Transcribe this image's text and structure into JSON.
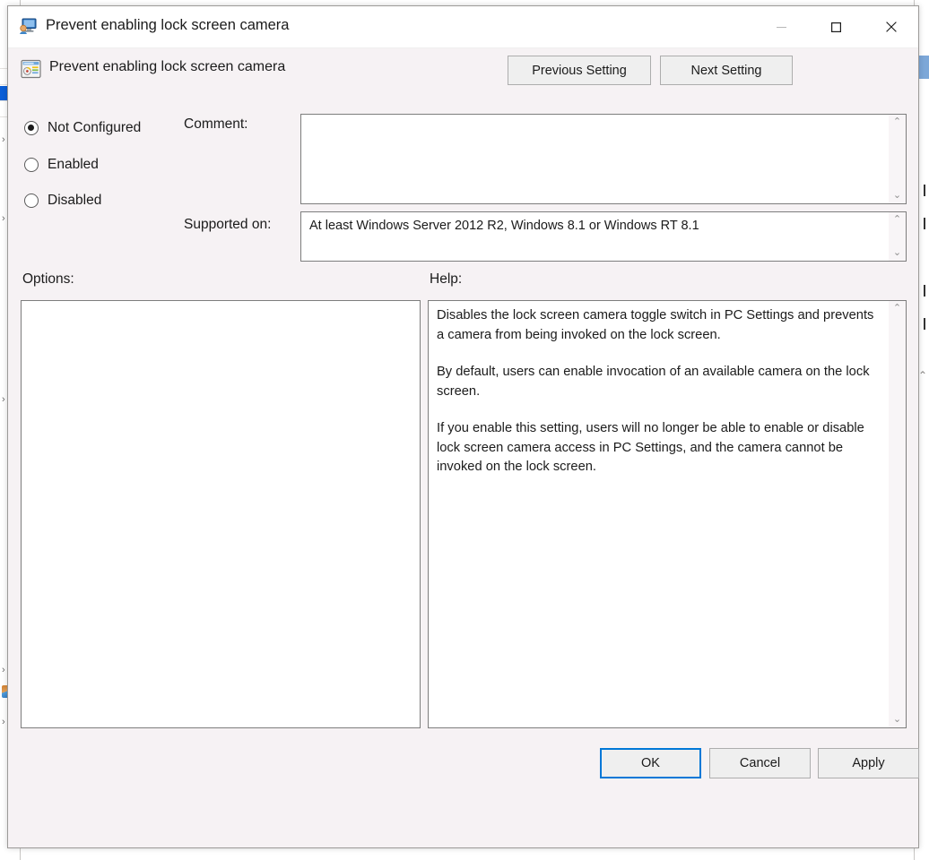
{
  "window": {
    "title": "Prevent enabling lock screen camera",
    "title_icon": "computer-monitor-icon",
    "minimize_label": "Minimize",
    "maximize_label": "Maximize",
    "close_label": "Close"
  },
  "header": {
    "title": "Prevent enabling lock screen camera",
    "icon": "policy-setting-icon",
    "previous_setting": "Previous Setting",
    "next_setting": "Next Setting"
  },
  "state": {
    "options": [
      {
        "label": "Not Configured",
        "selected": true
      },
      {
        "label": "Enabled",
        "selected": false
      },
      {
        "label": "Disabled",
        "selected": false
      }
    ]
  },
  "comment": {
    "label": "Comment:",
    "value": "",
    "scroll_up": "⌃",
    "scroll_down": "⌄"
  },
  "supported": {
    "label": "Supported on:",
    "value": "At least Windows Server 2012 R2, Windows 8.1 or Windows RT 8.1",
    "scroll_up": "⌃",
    "scroll_down": "⌄"
  },
  "sections": {
    "options_label": "Options:",
    "help_label": "Help:"
  },
  "options_panel": {
    "content": ""
  },
  "help": {
    "paragraphs": [
      "Disables the lock screen camera toggle switch in PC Settings and prevents a camera from being invoked on the lock screen.",
      "By default, users can enable invocation of an available camera on the lock screen.",
      "If you enable this setting, users will no longer be able to enable or disable lock screen camera access in PC Settings, and the camera cannot be invoked on the lock screen."
    ],
    "scroll_up": "⌃",
    "scroll_down": "⌄"
  },
  "footer": {
    "ok": "OK",
    "cancel": "Cancel",
    "apply": "Apply"
  },
  "colors": {
    "dialog_bg": "#f6f2f4",
    "titlebar_bg": "#ffffff",
    "focus_blue": "#0078d7",
    "selection_blue": "#0a5ed7",
    "button_face": "#efefef",
    "border": "#7d7d7d",
    "text": "#1b1b1b"
  },
  "background": {
    "left_tree_chevrons": [
      "›",
      "›",
      "›",
      "›",
      "›"
    ],
    "right_list_marks": [
      "",
      "",
      "",
      ""
    ]
  }
}
